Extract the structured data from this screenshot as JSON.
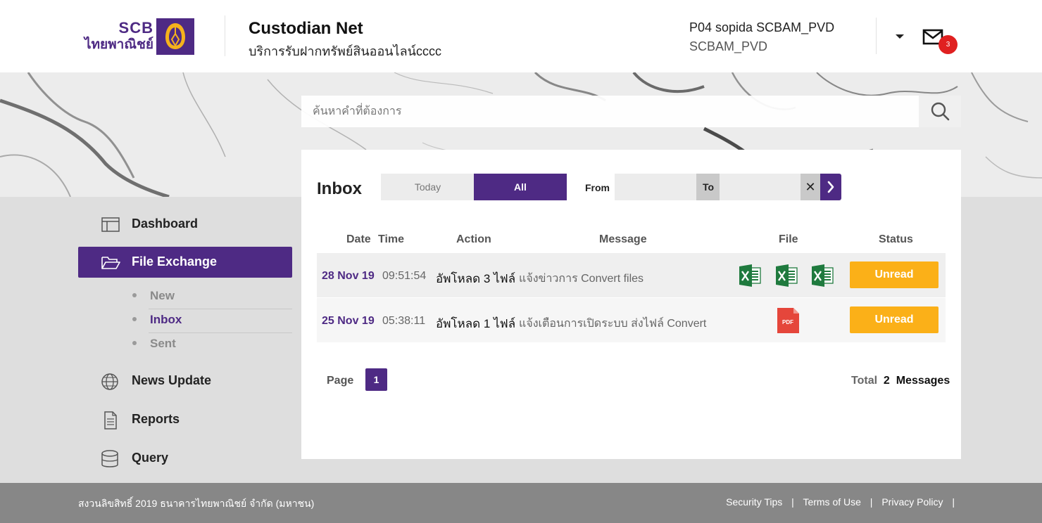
{
  "header": {
    "logo_text_en": "SCB",
    "logo_text_th": "ไทยพาณิชย์",
    "app_title": "Custodian Net",
    "app_subtitle": "บริการรับฝากทรัพย์สินออนไลน์cccc",
    "user_name": "P04 sopida SCBAM_PVD",
    "user_org": "SCBAM_PVD",
    "unread_count": "3",
    "icons": [
      "scb-logo-icon",
      "chevron-down-icon",
      "mail-icon"
    ]
  },
  "search": {
    "placeholder": "ค้นหาคำที่ต้องการ",
    "icon": "search-icon"
  },
  "sidebar": {
    "items": [
      {
        "label": "Dashboard",
        "icon": "dashboard-icon"
      },
      {
        "label": "File Exchange",
        "icon": "folder-open-icon",
        "active": true
      },
      {
        "label": "News Update",
        "icon": "globe-icon"
      },
      {
        "label": "Reports",
        "icon": "document-icon"
      },
      {
        "label": "Query",
        "icon": "database-icon"
      }
    ],
    "sub_items": [
      {
        "label": "New"
      },
      {
        "label": "Inbox",
        "active": true
      },
      {
        "label": "Sent"
      }
    ]
  },
  "inbox": {
    "title": "Inbox",
    "filters": {
      "today_label": "Today",
      "all_label": "All",
      "from_label": "From",
      "to_label": "To",
      "clear_label": "✕"
    },
    "columns": [
      "Date",
      "Time",
      "Action",
      "Message",
      "File",
      "Status"
    ],
    "rows": [
      {
        "date": "28 Nov 19",
        "time": "09:51:54",
        "action": "อัพโหลด 3 ไฟล์",
        "message": "แจ้งข่าวการ Convert files",
        "files": [
          "excel-file-icon",
          "excel-file-icon",
          "excel-file-icon"
        ],
        "status": "Unread"
      },
      {
        "date": "25 Nov 19",
        "time": "05:38:11",
        "action": "อัพโหลด 1 ไฟล์",
        "message": "แจ้งเตือนการเปิดระบบ ส่งไฟล์ Convert",
        "files": [
          "pdf-file-icon"
        ],
        "status": "Unread"
      }
    ],
    "pagination": {
      "label": "Page",
      "current": "1"
    },
    "total": {
      "prefix": "Total",
      "count": "2",
      "suffix": "Messages"
    }
  },
  "footer": {
    "copyright": "สงวนลิขสิทธิ์ 2019 ธนาคารไทยพาณิชย์ จำกัด (มหาชน)",
    "links": [
      "Security Tips",
      "Terms of Use",
      "Privacy Policy"
    ],
    "separator": "|"
  },
  "colors": {
    "brand_purple": "#4e2a84",
    "status_unread": "#fbb018",
    "badge_red": "#e02020",
    "excel_green": "#1f7a3e",
    "pdf_red": "#e5463b",
    "footer_grey": "#878787"
  }
}
